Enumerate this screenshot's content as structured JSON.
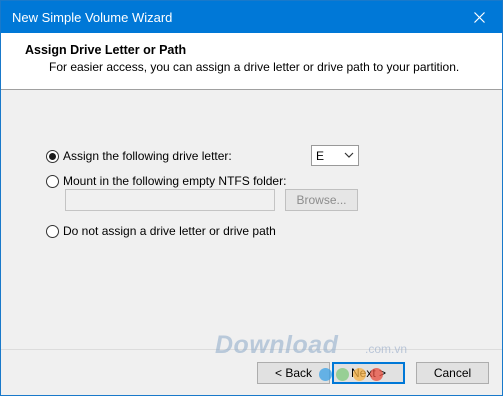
{
  "window": {
    "title": "New Simple Volume Wizard",
    "accent_color": "#0078d7"
  },
  "header": {
    "heading": "Assign Drive Letter or Path",
    "description": "For easier access, you can assign a drive letter or drive path to your partition."
  },
  "options": {
    "assign_letter": {
      "label": "Assign the following drive letter:",
      "checked": true
    },
    "mount_folder": {
      "label": "Mount in the following empty NTFS folder:",
      "checked": false
    },
    "no_assign": {
      "label": "Do not assign a drive letter or drive path",
      "checked": false
    }
  },
  "drive_letter": {
    "selected": "E"
  },
  "folder_path": {
    "value": ""
  },
  "buttons": {
    "browse": "Browse...",
    "back": "< Back",
    "next": "Next >",
    "cancel": "Cancel"
  },
  "watermark": {
    "brand": "Download",
    "domain": ".com.vn",
    "dot_colors": [
      "#3aa0e6",
      "#7ec87a",
      "#f5b041",
      "#e74c3c"
    ]
  }
}
